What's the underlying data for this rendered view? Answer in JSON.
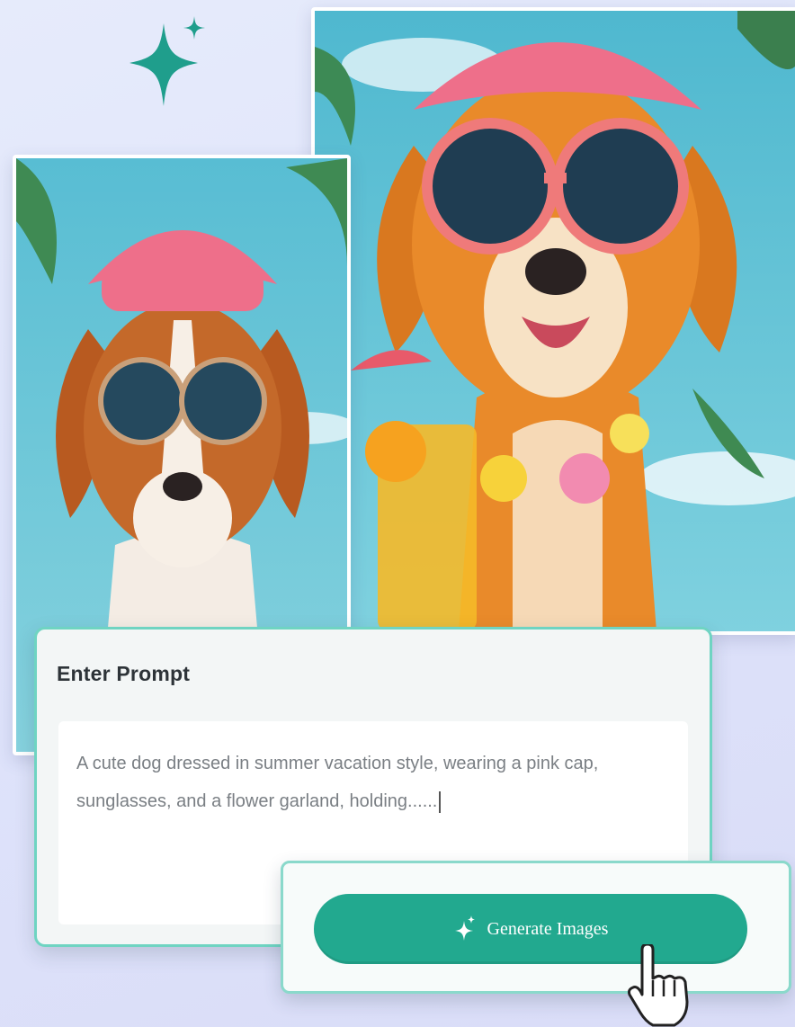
{
  "prompt": {
    "title": "Enter Prompt",
    "text": "A cute dog dressed in summer vacation style, wearing a pink cap, sunglasses, and a flower garland, holding......"
  },
  "actions": {
    "generate_label": "Generate Images"
  },
  "icons": {
    "sparkle": "sparkle-icon",
    "generate": "sparkle-generate-icon",
    "cursor": "hand-pointer-cursor-icon"
  },
  "colors": {
    "accent": "#22a98f",
    "panel_border": "#6fd4c2",
    "sparkle": "#1f9e8c",
    "cap_pink": "#ee6f8a",
    "sky": "#5bbfd4"
  }
}
